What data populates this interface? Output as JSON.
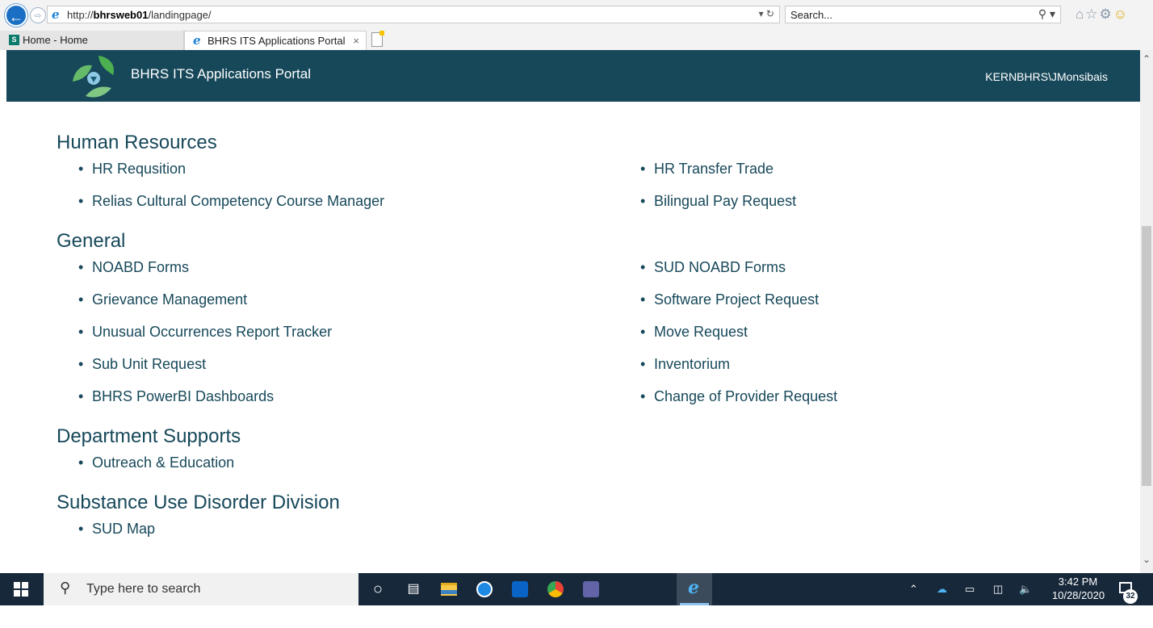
{
  "browser": {
    "url_prefix": "http://",
    "url_host": "bhrsweb01",
    "url_path": "/landingpage/",
    "address_tools": "▾ ↻",
    "search_placeholder": "Search...",
    "search_icon": "⚲ ▾",
    "tools_icons": [
      "home-icon",
      "favorites-star-icon",
      "settings-gear-icon",
      "feedback-smiley-icon"
    ],
    "tabs": [
      {
        "label": "Home - Home",
        "icon": "sharepoint-icon"
      },
      {
        "label": "BHRS ITS Applications Portal",
        "icon": "ie-icon",
        "close": "×"
      }
    ]
  },
  "navbar": {
    "brand": "BHRS ITS Applications Portal",
    "user": "KERNBHRS\\JMonsibais"
  },
  "sections": [
    {
      "title": "Human Resources",
      "links": [
        "HR Requsition",
        "HR Transfer Trade",
        "Relias Cultural Competency Course Manager",
        "Bilingual Pay Request"
      ]
    },
    {
      "title": "General",
      "links": [
        "NOABD Forms",
        "SUD NOABD Forms",
        "Grievance Management",
        "Software Project Request",
        "Unusual Occurrences Report Tracker",
        "Move Request",
        "Sub Unit Request",
        "Inventorium",
        "BHRS PowerBI Dashboards",
        "Change of Provider Request"
      ]
    },
    {
      "title": "Department Supports",
      "links": [
        "Outreach & Education"
      ]
    },
    {
      "title": "Substance Use Disorder Division",
      "links": [
        "SUD Map"
      ]
    }
  ],
  "taskbar": {
    "search_placeholder": "Type here to search",
    "pinned": [
      "cortana-icon",
      "task-view-icon",
      "file-explorer-icon",
      "maps-icon",
      "outlook-icon",
      "chrome-icon",
      "teams-icon",
      "internet-explorer-icon"
    ],
    "time": "3:42 PM",
    "date": "10/28/2020",
    "notification_count": "32"
  },
  "colors": {
    "navbar": "#17485a",
    "link": "#17485a",
    "taskbar": "#17283a"
  }
}
